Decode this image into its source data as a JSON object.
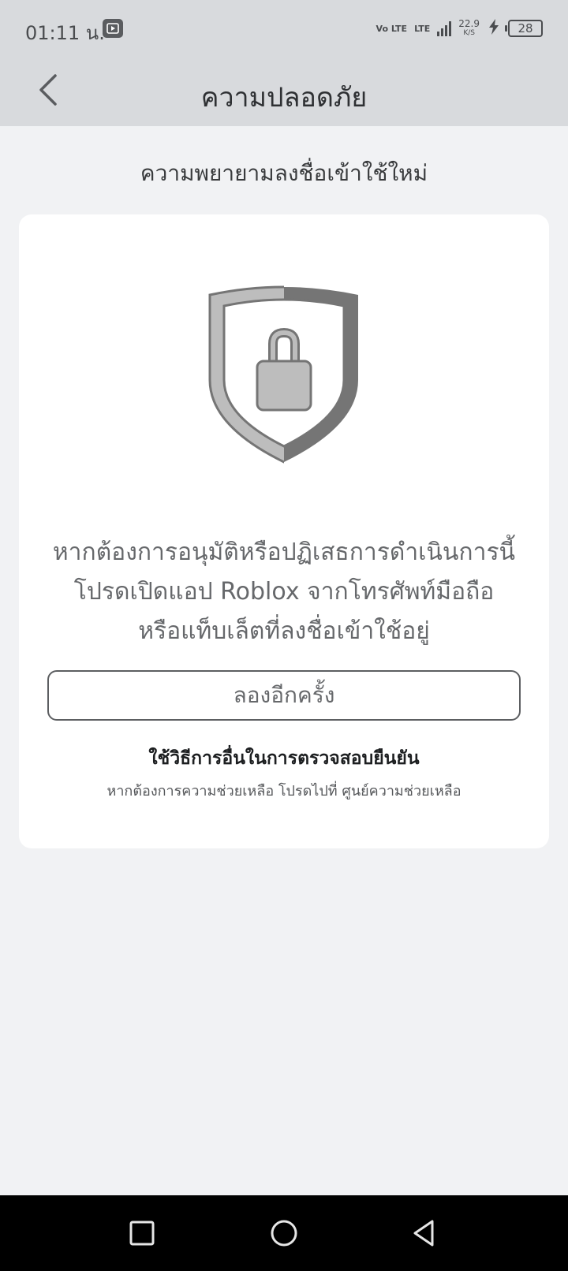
{
  "status_bar": {
    "time": "01:11 น.",
    "network": "Vo LTE",
    "lte_label": "LTE",
    "speed_value": "22.9",
    "speed_unit": "K/S",
    "battery_level": "28"
  },
  "app_bar": {
    "title": "ความปลอดภัย"
  },
  "subtitle": "ความพยายามลงชื่อเข้าใช้ใหม่",
  "card": {
    "message_lines": [
      "หากต้องการอนุมัติหรือปฏิเสธการดำเนินการนี้",
      "โปรดเปิดแอป Roblox จากโทรศัพท์มือถือ",
      "หรือแท็บเล็ตที่ลงชื่อเข้าใช้อยู่"
    ],
    "retry_label": "ลองอีกครั้ง",
    "alt_method_label": "ใช้วิธีการอื่นในการตรวจสอบยืนยัน",
    "help_prefix": "หากต้องการความช่วยเหลือ โปรดไปที่",
    "help_link": "ศูนย์ความช่วยเหลือ"
  },
  "colors": {
    "header_bg": "#d8dadd",
    "page_bg": "#f1f2f4",
    "card_bg": "#ffffff",
    "shield_light": "#bdbdbd",
    "shield_dark": "#757575"
  },
  "icons": {
    "back": "chevron-left-icon",
    "shield": "shield-lock-icon",
    "nav_recents": "square-icon",
    "nav_home": "circle-icon",
    "nav_back": "triangle-back-icon"
  }
}
